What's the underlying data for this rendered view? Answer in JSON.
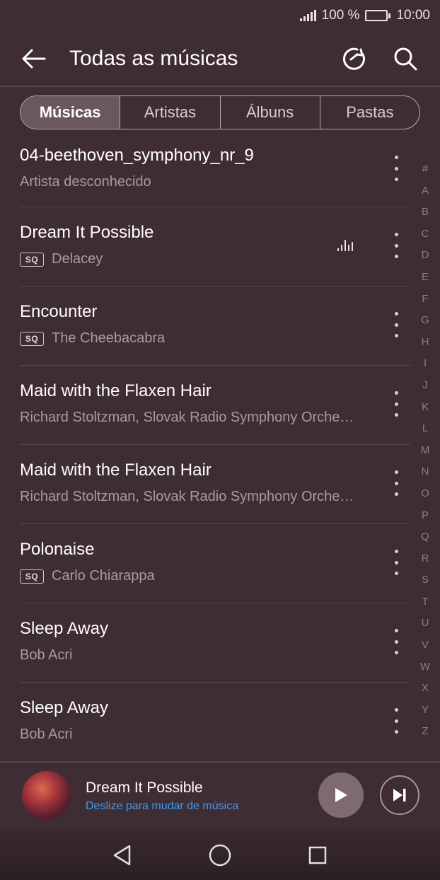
{
  "status_bar": {
    "battery_text": "100 %",
    "time": "10:00",
    "battery_level": 1.0
  },
  "app_bar": {
    "title": "Todas as músicas",
    "back_icon": "arrow-left-icon",
    "refresh_icon": "refresh-icon",
    "search_icon": "search-icon"
  },
  "tabs": [
    {
      "label": "Músicas",
      "active": true
    },
    {
      "label": "Artistas",
      "active": false
    },
    {
      "label": "Álbuns",
      "active": false
    },
    {
      "label": "Pastas",
      "active": false
    }
  ],
  "songs": [
    {
      "title": "04-beethoven_symphony_nr_9",
      "artist": "Artista desconhecido",
      "sq": false,
      "playing": false
    },
    {
      "title": "Dream It Possible",
      "artist": "Delacey",
      "sq": true,
      "playing": true
    },
    {
      "title": "Encounter",
      "artist": "The Cheebacabra",
      "sq": true,
      "playing": false
    },
    {
      "title": "Maid with the Flaxen Hair",
      "artist": "Richard Stoltzman, Slovak Radio Symphony Orche…",
      "sq": false,
      "playing": false
    },
    {
      "title": "Maid with the Flaxen Hair",
      "artist": "Richard Stoltzman, Slovak Radio Symphony Orche…",
      "sq": false,
      "playing": false
    },
    {
      "title": "Polonaise",
      "artist": "Carlo Chiarappa",
      "sq": true,
      "playing": false
    },
    {
      "title": "Sleep Away",
      "artist": "Bob Acri",
      "sq": false,
      "playing": false
    },
    {
      "title": "Sleep Away",
      "artist": "Bob Acri",
      "sq": false,
      "playing": false
    }
  ],
  "sq_badge": "SQ",
  "alpha_index": [
    "#",
    "A",
    "B",
    "C",
    "D",
    "E",
    "F",
    "G",
    "H",
    "I",
    "J",
    "K",
    "L",
    "M",
    "N",
    "O",
    "P",
    "Q",
    "R",
    "S",
    "T",
    "U",
    "V",
    "W",
    "X",
    "Y",
    "Z"
  ],
  "now_playing": {
    "title": "Dream It Possible",
    "hint": "Deslize para mudar de música"
  },
  "colors": {
    "background": "#3f2d35",
    "accent_link": "#3f9bf0",
    "secondary_text": "#a99aa2"
  }
}
